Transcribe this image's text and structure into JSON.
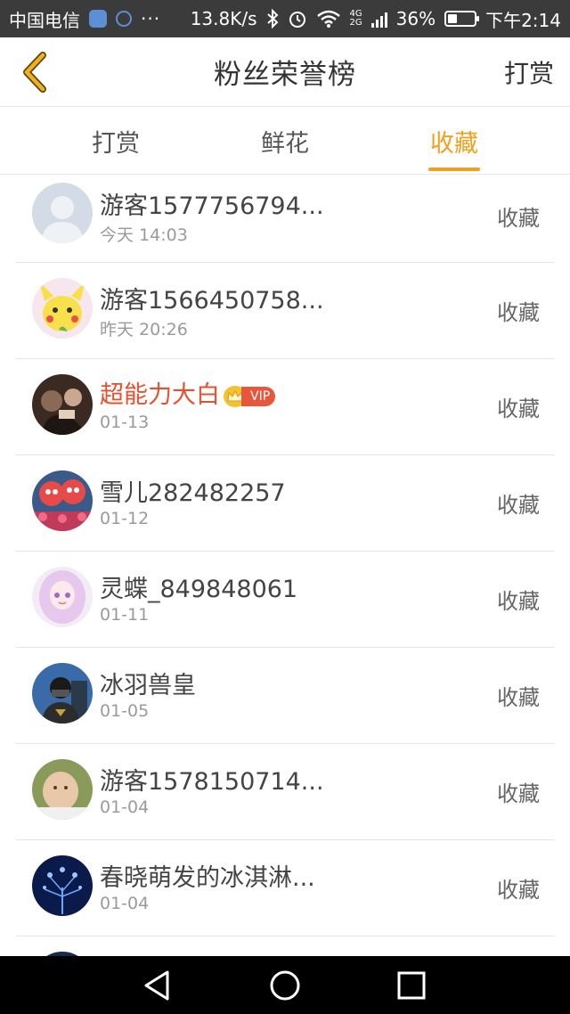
{
  "status_bar": {
    "carrier": "中国电信",
    "dots": "···",
    "speed": "13.8K/s",
    "net_top": "4G",
    "net_bottom": "2G",
    "battery": "36%",
    "battery_level": 0.36,
    "time": "下午2:14"
  },
  "header": {
    "title": "粉丝荣誉榜",
    "action_label": "打赏"
  },
  "tabs": [
    {
      "label": "打赏",
      "active": false
    },
    {
      "label": "鲜花",
      "active": false
    },
    {
      "label": "收藏",
      "active": true
    }
  ],
  "colors": {
    "accent": "#f0a020",
    "vip_name": "#e8502e",
    "status_bar_bg": "#3b3b3b"
  },
  "list": {
    "items": [
      {
        "name": "游客1577756794...",
        "date": "今天 14:03",
        "action": "收藏",
        "avatar": "default-user-avatar",
        "vip": false
      },
      {
        "name": "游客1566450758...",
        "date": "昨天 20:26",
        "action": "收藏",
        "avatar": "cartoon-pikachu-avatar",
        "vip": false
      },
      {
        "name": "超能力大白",
        "date": "01-13",
        "action": "收藏",
        "avatar": "photo-avatar",
        "vip": true,
        "vip_label": "VIP"
      },
      {
        "name": "雪儿282482257",
        "date": "01-12",
        "action": "收藏",
        "avatar": "cartoon-flowers-avatar",
        "vip": false
      },
      {
        "name": "灵蝶_849848061",
        "date": "01-11",
        "action": "收藏",
        "avatar": "anime-girl-avatar",
        "vip": false
      },
      {
        "name": "冰羽兽皇",
        "date": "01-05",
        "action": "收藏",
        "avatar": "masked-character-avatar",
        "vip": false
      },
      {
        "name": "游客1578150714...",
        "date": "01-04",
        "action": "收藏",
        "avatar": "baby-photo-avatar",
        "vip": false
      },
      {
        "name": "春晓萌发的冰淇淋...",
        "date": "01-04",
        "action": "收藏",
        "avatar": "glowing-tree-avatar",
        "vip": false
      }
    ]
  },
  "nav": {
    "back_icon": "triangle-back-icon",
    "home_icon": "circle-home-icon",
    "recent_icon": "square-recent-icon"
  }
}
